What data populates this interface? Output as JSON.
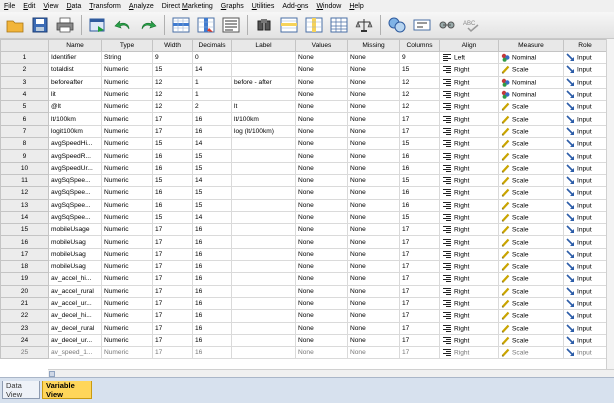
{
  "menu": [
    {
      "u": "F",
      "rest": "ile"
    },
    {
      "u": "E",
      "rest": "dit"
    },
    {
      "u": "V",
      "rest": "iew"
    },
    {
      "u": "D",
      "rest": "ata"
    },
    {
      "u": "T",
      "rest": "ransform"
    },
    {
      "u": "A",
      "rest": "nalyze"
    },
    {
      "u": "",
      "rest": "Direct ",
      "u2": "M",
      "rest2": "arketing"
    },
    {
      "u": "G",
      "rest": "raphs"
    },
    {
      "u": "U",
      "rest": "tilities"
    },
    {
      "u": "",
      "rest": "Add-",
      "u2": "o",
      "rest2": "ns"
    },
    {
      "u": "W",
      "rest": "indow"
    },
    {
      "u": "H",
      "rest": "elp"
    }
  ],
  "toolbar_icons": [
    "open-folder-icon",
    "save-icon",
    "print-icon",
    "dialog-recall-icon",
    "undo-icon",
    "redo-icon",
    "goto-case-icon",
    "goto-variable-icon",
    "variables-icon",
    "find-icon",
    "insert-cases-icon",
    "insert-variable-icon",
    "split-file-icon",
    "weight-cases-icon",
    "select-cases-icon",
    "value-labels-icon",
    "use-sets-icon",
    "spelling-icon"
  ],
  "columns": [
    "",
    "Name",
    "Type",
    "Width",
    "Decimals",
    "Label",
    "Values",
    "Missing",
    "Columns",
    "Align",
    "Measure",
    "Role"
  ],
  "colors": {
    "accent_tab": "#ffd65a",
    "scale_icon": "#c9a400",
    "nominal_icon": "#c43a3a",
    "role_icon": "#2b5ca8"
  },
  "rows": [
    [
      "1",
      "Identifier",
      "String",
      "9",
      "0",
      "",
      "None",
      "None",
      "9",
      "Left",
      "Nominal",
      "Input"
    ],
    [
      "2",
      "totaldist",
      "Numeric",
      "15",
      "14",
      "",
      "None",
      "None",
      "15",
      "Right",
      "Scale",
      "Input"
    ],
    [
      "3",
      "beforeafter",
      "Numeric",
      "12",
      "1",
      "before - after",
      "None",
      "None",
      "12",
      "Right",
      "Nominal",
      "Input"
    ],
    [
      "4",
      "lit",
      "Numeric",
      "12",
      "1",
      "",
      "None",
      "None",
      "12",
      "Right",
      "Nominal",
      "Input"
    ],
    [
      "5",
      "@lt",
      "Numeric",
      "12",
      "2",
      "lt",
      "None",
      "None",
      "12",
      "Right",
      "Scale",
      "Input"
    ],
    [
      "6",
      "lt/100km",
      "Numeric",
      "17",
      "16",
      "lt/100km",
      "None",
      "None",
      "17",
      "Right",
      "Scale",
      "Input"
    ],
    [
      "7",
      "logit100km",
      "Numeric",
      "17",
      "16",
      "log (lt/100km)",
      "None",
      "None",
      "17",
      "Right",
      "Scale",
      "Input"
    ],
    [
      "8",
      "avgSpeedHi...",
      "Numeric",
      "15",
      "14",
      "",
      "None",
      "None",
      "15",
      "Right",
      "Scale",
      "Input"
    ],
    [
      "9",
      "avgSpeedR...",
      "Numeric",
      "16",
      "15",
      "",
      "None",
      "None",
      "16",
      "Right",
      "Scale",
      "Input"
    ],
    [
      "10",
      "avgSpeedUr...",
      "Numeric",
      "16",
      "15",
      "",
      "None",
      "None",
      "16",
      "Right",
      "Scale",
      "Input"
    ],
    [
      "11",
      "avgSqSpee...",
      "Numeric",
      "15",
      "14",
      "",
      "None",
      "None",
      "15",
      "Right",
      "Scale",
      "Input"
    ],
    [
      "12",
      "avgSqSpee...",
      "Numeric",
      "16",
      "15",
      "",
      "None",
      "None",
      "16",
      "Right",
      "Scale",
      "Input"
    ],
    [
      "13",
      "avgSqSpee...",
      "Numeric",
      "16",
      "15",
      "",
      "None",
      "None",
      "16",
      "Right",
      "Scale",
      "Input"
    ],
    [
      "14",
      "avgSqSpee...",
      "Numeric",
      "15",
      "14",
      "",
      "None",
      "None",
      "15",
      "Right",
      "Scale",
      "Input"
    ],
    [
      "15",
      "mobileUsage",
      "Numeric",
      "17",
      "16",
      "",
      "None",
      "None",
      "17",
      "Right",
      "Scale",
      "Input"
    ],
    [
      "16",
      "mobileUsag",
      "Numeric",
      "17",
      "16",
      "",
      "None",
      "None",
      "17",
      "Right",
      "Scale",
      "Input"
    ],
    [
      "17",
      "mobileUsag",
      "Numeric",
      "17",
      "16",
      "",
      "None",
      "None",
      "17",
      "Right",
      "Scale",
      "Input"
    ],
    [
      "18",
      "mobileUsag",
      "Numeric",
      "17",
      "16",
      "",
      "None",
      "None",
      "17",
      "Right",
      "Scale",
      "Input"
    ],
    [
      "19",
      "av_accel_hi...",
      "Numeric",
      "17",
      "16",
      "",
      "None",
      "None",
      "17",
      "Right",
      "Scale",
      "Input"
    ],
    [
      "20",
      "av_accel_rural",
      "Numeric",
      "17",
      "16",
      "",
      "None",
      "None",
      "17",
      "Right",
      "Scale",
      "Input"
    ],
    [
      "21",
      "av_accel_ur...",
      "Numeric",
      "17",
      "16",
      "",
      "None",
      "None",
      "17",
      "Right",
      "Scale",
      "Input"
    ],
    [
      "22",
      "av_decel_hi...",
      "Numeric",
      "17",
      "16",
      "",
      "None",
      "None",
      "17",
      "Right",
      "Scale",
      "Input"
    ],
    [
      "23",
      "av_decel_rural",
      "Numeric",
      "17",
      "16",
      "",
      "None",
      "None",
      "17",
      "Right",
      "Scale",
      "Input"
    ],
    [
      "24",
      "av_decel_ur...",
      "Numeric",
      "17",
      "16",
      "",
      "None",
      "None",
      "17",
      "Right",
      "Scale",
      "Input"
    ],
    [
      "25",
      "av_speed_1...",
      "Numeric",
      "17",
      "16",
      "",
      "None",
      "None",
      "17",
      "Right",
      "Scale",
      "Input"
    ]
  ],
  "tabs": {
    "data_view": "Data View",
    "variable_view": "Variable View"
  }
}
